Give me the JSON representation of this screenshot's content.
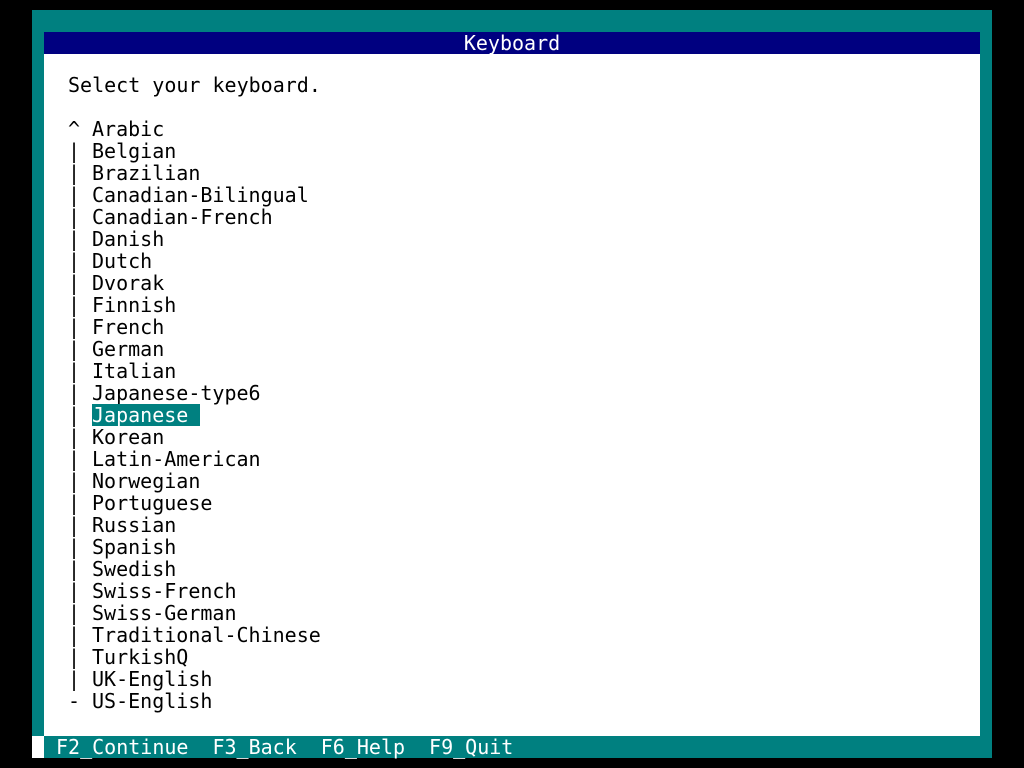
{
  "title": "Keyboard",
  "prompt": "Select your keyboard.",
  "keyboards": [
    {
      "marker": "^",
      "label": "Arabic"
    },
    {
      "marker": "|",
      "label": "Belgian"
    },
    {
      "marker": "|",
      "label": "Brazilian"
    },
    {
      "marker": "|",
      "label": "Canadian-Bilingual"
    },
    {
      "marker": "|",
      "label": "Canadian-French"
    },
    {
      "marker": "|",
      "label": "Danish"
    },
    {
      "marker": "|",
      "label": "Dutch"
    },
    {
      "marker": "|",
      "label": "Dvorak"
    },
    {
      "marker": "|",
      "label": "Finnish"
    },
    {
      "marker": "|",
      "label": "French"
    },
    {
      "marker": "|",
      "label": "German"
    },
    {
      "marker": "|",
      "label": "Italian"
    },
    {
      "marker": "|",
      "label": "Japanese-type6"
    },
    {
      "marker": "|",
      "label": "Japanese",
      "selected": true
    },
    {
      "marker": "|",
      "label": "Korean"
    },
    {
      "marker": "|",
      "label": "Latin-American"
    },
    {
      "marker": "|",
      "label": "Norwegian"
    },
    {
      "marker": "|",
      "label": "Portuguese"
    },
    {
      "marker": "|",
      "label": "Russian"
    },
    {
      "marker": "|",
      "label": "Spanish"
    },
    {
      "marker": "|",
      "label": "Swedish"
    },
    {
      "marker": "|",
      "label": "Swiss-French"
    },
    {
      "marker": "|",
      "label": "Swiss-German"
    },
    {
      "marker": "|",
      "label": "Traditional-Chinese"
    },
    {
      "marker": "|",
      "label": "TurkishQ"
    },
    {
      "marker": "|",
      "label": "UK-English"
    },
    {
      "marker": "-",
      "label": "US-English"
    }
  ],
  "footer": {
    "continue": "F2_Continue",
    "back": "F3_Back",
    "help": "F6_Help",
    "quit": "F9_Quit"
  },
  "colors": {
    "background": "#008080",
    "title_bar": "#000080",
    "selection": "#008080",
    "panel": "#ffffff"
  }
}
